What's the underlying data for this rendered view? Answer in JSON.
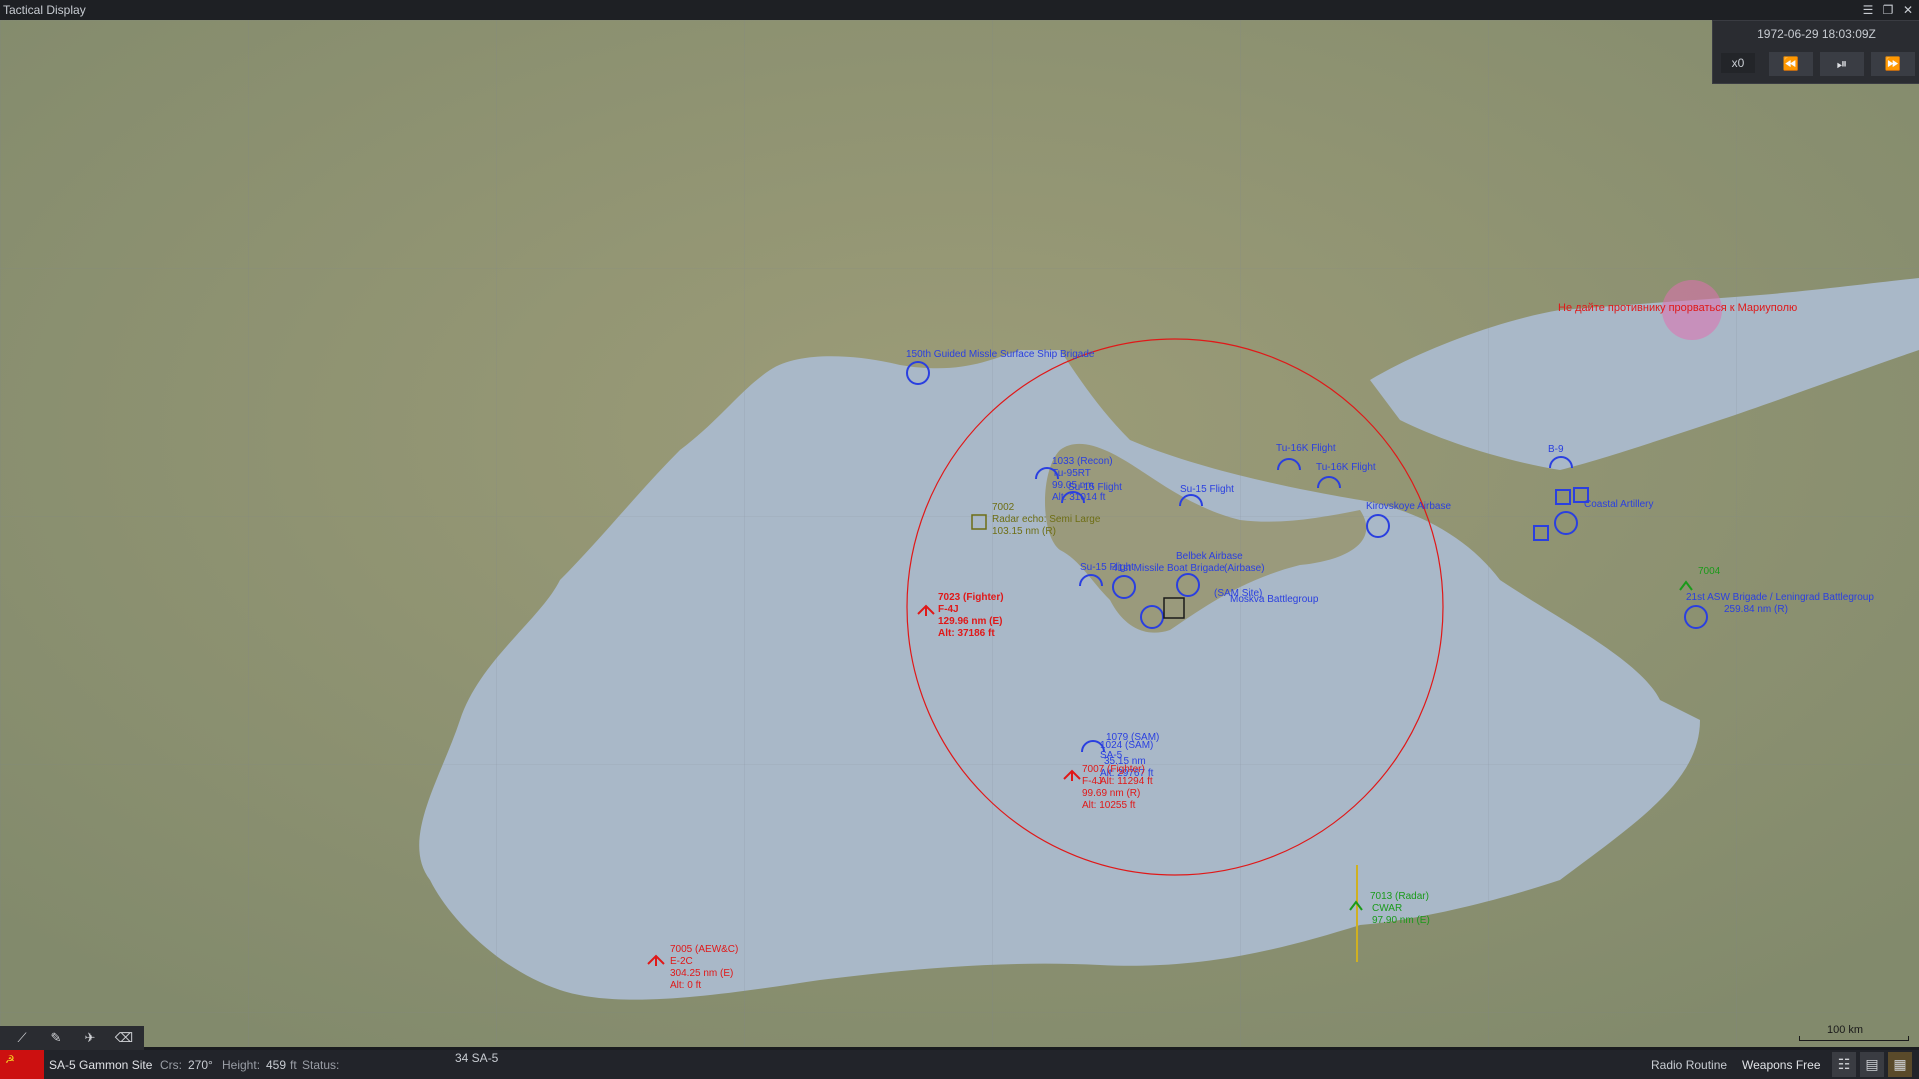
{
  "window": {
    "title": "Tactical Display"
  },
  "window_buttons": [
    "☰",
    "❐",
    "✕"
  ],
  "time_panel": {
    "datetime": "1972-06-29 18:03:09Z",
    "speed": "x0",
    "rewind_icon": "rewind-icon",
    "play_pause_icon": "play-pause-icon",
    "fast_forward_icon": "fast-forward-icon"
  },
  "colors": {
    "friendly": "#2a3fe0",
    "hostile": "#e01818",
    "unknown": "#6e6e14",
    "neutral": "#1a9a1a",
    "range_ring": "#e01818"
  },
  "map_labels": {
    "objective": "Не дайте противнику прорваться к Мариуполю",
    "brigade_150": "150th Guided Missle Surface Ship Brigade",
    "recon_1033_a": "1033 (Recon)",
    "recon_1033_b": "Tu-95RT",
    "recon_1033_c": "99.05 nm",
    "recon_1033_d": "Alt: 31014 ft",
    "su15_flight_a": "Su-15 Flight",
    "su15_flight_b": "Su-15 Flight",
    "su15_flight_c": "Su-15 Flight",
    "tu16_flight_a": "Tu-16K Flight",
    "tu16_flight_b": "Tu-16K Flight",
    "kirovskoye": "Kirovskoye Airbase",
    "b9": "B-9",
    "coastal_artillery": "Coastal Artillery",
    "belbek": "Belbek Airbase",
    "missile_boat": "41st Missile Boat Brigade",
    "airbase_paren": "(Airbase)",
    "sam_site": "(SAM Site)",
    "moskva": "Moskva Battlegroup",
    "leningrad": "21st ASW Brigade / Leningrad Battlegroup",
    "leningrad_range": "259.84 nm (R)",
    "contact_7002_a": "7002",
    "contact_7002_b": "Radar echo: Semi Large",
    "contact_7002_c": "103.15 nm (R)",
    "contact_7023_a": "7023 (Fighter)",
    "contact_7023_b": "F-4J",
    "contact_7023_c": "129.96 nm (E)",
    "contact_7023_d": "Alt: 37186 ft",
    "sam_1079_a": "1079 (SAM)",
    "sam_1079_b": "1024 (SAM)",
    "sam_1079_c": "SA-5",
    "sam_1079_d": "35.15 nm",
    "sam_1079_e": "Alt: 29767 ft",
    "contact_7007_a": "7007 (Fighter)",
    "contact_7007_b": "F-4J",
    "contact_7007_c": "Alt: 11294 ft",
    "contact_7007_d": "99.69 nm (R)",
    "contact_7007_e": "Alt: 10255 ft",
    "contact_7013_a": "7013 (Radar)",
    "contact_7013_b": "CWAR",
    "contact_7013_c": "97.90 nm (E)",
    "contact_7005_a": "7005 (AEW&C)",
    "contact_7005_b": "E-2C",
    "contact_7005_c": "304.25 nm (E)",
    "contact_7005_d": "Alt: 0 ft",
    "contact_7004": "7004"
  },
  "scale_bar": "100 km",
  "toolbar": {
    "tools": [
      "ruler-icon",
      "pencil-icon",
      "aircraft-tool-icon",
      "eraser-icon"
    ]
  },
  "status": {
    "unit_name": "SA-5 Gammon Site",
    "crs_label": "Crs:",
    "crs_value": "270°",
    "height_label": "Height:",
    "height_value": "459",
    "height_unit": "ft",
    "status_label": "Status:",
    "weapon_count": "34 SA-5",
    "radio": "Radio Routine",
    "weapons": "Weapons Free"
  }
}
